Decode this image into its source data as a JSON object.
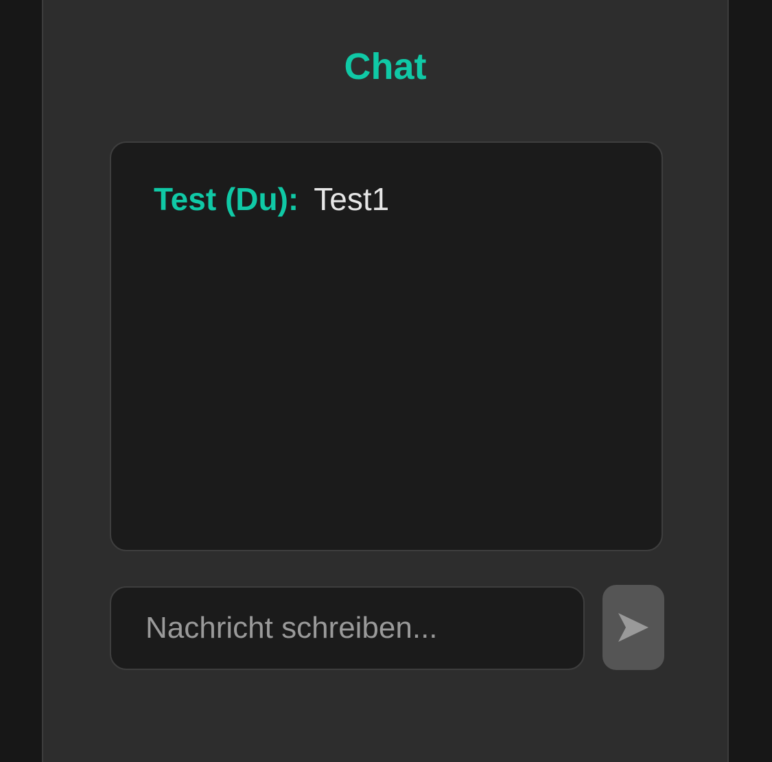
{
  "header": {
    "title": "Chat"
  },
  "messages": [
    {
      "sender": "Test (Du):",
      "text": "Test1"
    }
  ],
  "composer": {
    "placeholder": "Nachricht schreiben...",
    "value": "",
    "send_icon": "send-icon"
  },
  "colors": {
    "accent": "#10c9a6",
    "page_background": "#171717",
    "panel_background": "#2d2d2d",
    "box_background": "#1b1b1b",
    "send_button": "#555555"
  }
}
